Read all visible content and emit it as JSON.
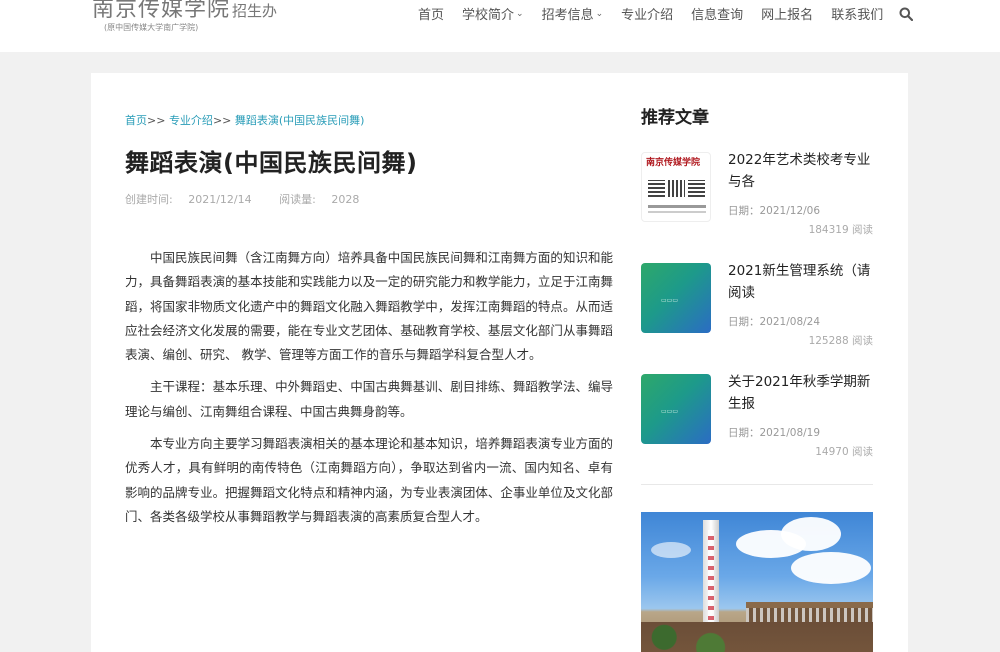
{
  "header": {
    "logo_main": "南京传媒学院",
    "logo_suffix": "招生办",
    "logo_sub": "(原中国传媒大学南广学院)",
    "nav": [
      {
        "label": "首页",
        "dropdown": false
      },
      {
        "label": "学校简介",
        "dropdown": true
      },
      {
        "label": "招考信息",
        "dropdown": true
      },
      {
        "label": "专业介绍",
        "dropdown": false
      },
      {
        "label": "信息查询",
        "dropdown": false
      },
      {
        "label": "网上报名",
        "dropdown": false
      },
      {
        "label": "联系我们",
        "dropdown": false
      }
    ],
    "search_icon": "search-icon"
  },
  "breadcrumb": {
    "home": "首页",
    "sep": ">>",
    "category": "专业介绍",
    "current": "舞蹈表演(中国民族民间舞)"
  },
  "article": {
    "title": "舞蹈表演(中国民族民间舞)",
    "created_label": "创建时间:",
    "created_date": "2021/12/14",
    "views_label": "阅读量:",
    "views": "2028",
    "paragraphs": [
      "中国民族民间舞（含江南舞方向）培养具备中国民族民间舞和江南舞方面的知识和能力，具备舞蹈表演的基本技能和实践能力以及一定的研究能力和教学能力，立足于江南舞蹈，将国家非物质文化遗产中的舞蹈文化融入舞蹈教学中，发挥江南舞蹈的特点。从而适应社会经济文化发展的需要，能在专业文艺团体、基础教育学校、基层文化部门从事舞蹈表演、编创、研究、 教学、管理等方面工作的音乐与舞蹈学科复合型人才。",
      "主干课程：基本乐理、中外舞蹈史、中国古典舞基训、剧目排练、舞蹈教学法、编导理论与编创、江南舞组合课程、中国古典舞身韵等。",
      "本专业方向主要学习舞蹈表演相关的基本理论和基本知识，培养舞蹈表演专业方面的优秀人才，具有鲜明的南传特色（江南舞蹈方向），争取达到省内一流、国内知名、卓有影响的品牌专业。把握舞蹈文化特点和精神内涵，为专业表演团体、企事业单位及文化部门、各类各级学校从事舞蹈教学与舞蹈表演的高素质复合型人才。"
    ]
  },
  "sidebar": {
    "title": "推荐文章",
    "items": [
      {
        "title": "2022年艺术类校考专业与各",
        "date_label": "日期：",
        "date": "2021/12/06",
        "views": "184319",
        "views_label": "阅读",
        "thumb": "poster",
        "poster_text": "南京传媒学院"
      },
      {
        "title": "2021新生管理系统（请阅读",
        "date_label": "日期：",
        "date": "2021/08/24",
        "views": "125288",
        "views_label": "阅读",
        "thumb": "green"
      },
      {
        "title": "关于2021年秋季学期新生报",
        "date_label": "日期：",
        "date": "2021/08/19",
        "views": "14970",
        "views_label": "阅读",
        "thumb": "green"
      }
    ]
  }
}
